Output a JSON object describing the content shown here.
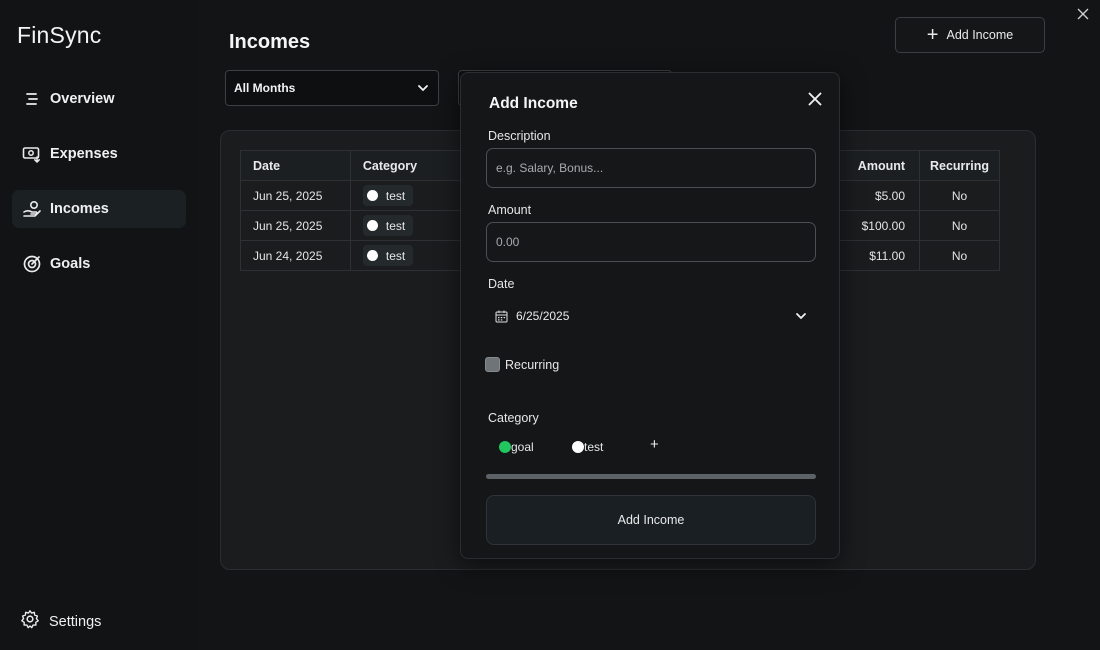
{
  "app": {
    "name": "FinSync"
  },
  "sidebar": {
    "items": [
      {
        "label": "Overview",
        "icon": "overview-icon",
        "active": false
      },
      {
        "label": "Expenses",
        "icon": "expenses-icon",
        "active": false
      },
      {
        "label": "Incomes",
        "icon": "incomes-icon",
        "active": true
      },
      {
        "label": "Goals",
        "icon": "goals-icon",
        "active": false
      }
    ],
    "settings_label": "Settings"
  },
  "header": {
    "title": "Incomes",
    "add_button_label": "Add Income"
  },
  "filters": {
    "month_value": "All Months"
  },
  "table": {
    "columns": [
      "Date",
      "Category",
      "Amount",
      "Recurring"
    ],
    "rows": [
      {
        "date": "Jun 25, 2025",
        "category": "test",
        "amount": "$5.00",
        "recurring": "No"
      },
      {
        "date": "Jun 25, 2025",
        "category": "test",
        "amount": "$100.00",
        "recurring": "No"
      },
      {
        "date": "Jun 24, 2025",
        "category": "test",
        "amount": "$11.00",
        "recurring": "No"
      }
    ]
  },
  "modal": {
    "title": "Add Income",
    "description_label": "Description",
    "description_placeholder": "e.g. Salary, Bonus...",
    "amount_label": "Amount",
    "amount_placeholder": "0.00",
    "date_label": "Date",
    "date_value": "6/25/2025",
    "recurring_label": "Recurring",
    "recurring_checked": false,
    "category_label": "Category",
    "categories": [
      {
        "label": "goal",
        "color": "#22c55e"
      },
      {
        "label": "test",
        "color": "#ffffff"
      }
    ],
    "add_category_label": "+",
    "submit_label": "Add Income"
  },
  "colors": {
    "background": "#0f1112",
    "sidebar_active": "#1b2022",
    "goal_category": "#22c55e",
    "test_category": "#ffffff"
  }
}
